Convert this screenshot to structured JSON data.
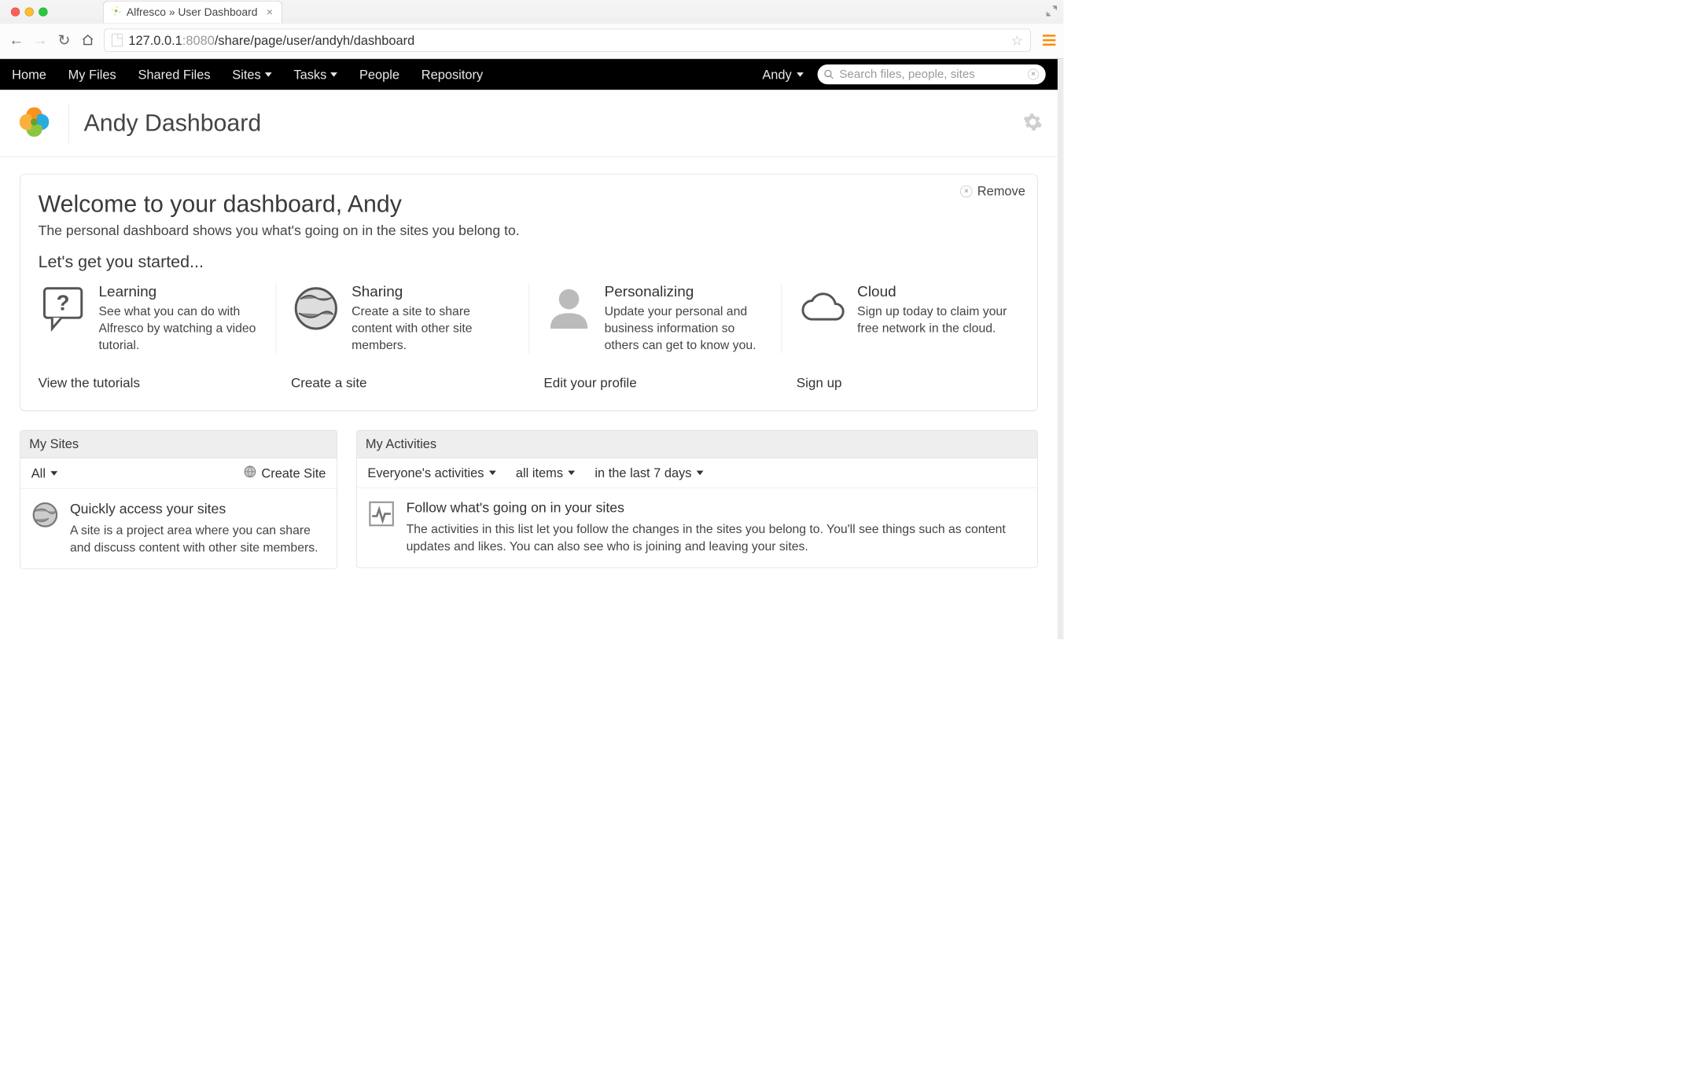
{
  "browser": {
    "tab_title": "Alfresco » User Dashboard",
    "url_host": "127.0.0.1",
    "url_port": ":8080",
    "url_path": "/share/page/user/andyh/dashboard"
  },
  "nav": {
    "home": "Home",
    "my_files": "My Files",
    "shared_files": "Shared Files",
    "sites": "Sites",
    "tasks": "Tasks",
    "people": "People",
    "repository": "Repository",
    "user": "Andy",
    "search_placeholder": "Search files, people, sites"
  },
  "header": {
    "title": "Andy Dashboard"
  },
  "welcome": {
    "remove": "Remove",
    "title": "Welcome to your dashboard, Andy",
    "subtitle": "The personal dashboard shows you what's going on in the sites you belong to.",
    "get_started": "Let's get you started...",
    "tiles": {
      "learning": {
        "title": "Learning",
        "desc": "See what you can do with Alfresco by watching a video tutorial.",
        "link": "View the tutorials"
      },
      "sharing": {
        "title": "Sharing",
        "desc": "Create a site to share content with other site members.",
        "link": "Create a site"
      },
      "personal": {
        "title": "Personalizing",
        "desc": "Update your personal and business information so others can get to know you.",
        "link": "Edit your profile"
      },
      "cloud": {
        "title": "Cloud",
        "desc": "Sign up today to claim your free network in the cloud.",
        "link": "Sign up"
      }
    }
  },
  "dashlets": {
    "my_sites": {
      "header": "My Sites",
      "filter": "All",
      "create": "Create Site",
      "body_title": "Quickly access your sites",
      "body_desc": "A site is a project area where you can share and discuss content with other site members."
    },
    "my_activities": {
      "header": "My Activities",
      "filters": {
        "who": "Everyone's activities",
        "what": "all items",
        "when": "in the last 7 days"
      },
      "body_title": "Follow what's going on in your sites",
      "body_desc": "The activities in this list let you follow the changes in the sites you belong to. You'll see things such as content updates and likes. You can also see who is joining and leaving your sites."
    }
  }
}
